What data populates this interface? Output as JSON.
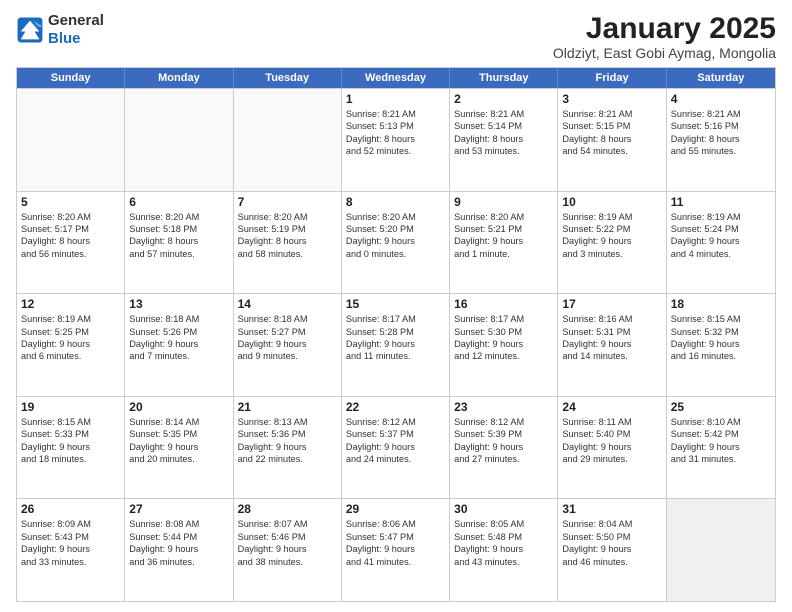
{
  "header": {
    "logo_general": "General",
    "logo_blue": "Blue",
    "month_title": "January 2025",
    "location": "Oldziyt, East Gobi Aymag, Mongolia"
  },
  "days_of_week": [
    "Sunday",
    "Monday",
    "Tuesday",
    "Wednesday",
    "Thursday",
    "Friday",
    "Saturday"
  ],
  "rows": [
    [
      {
        "num": "",
        "lines": [],
        "empty": true
      },
      {
        "num": "",
        "lines": [],
        "empty": true
      },
      {
        "num": "",
        "lines": [],
        "empty": true
      },
      {
        "num": "1",
        "lines": [
          "Sunrise: 8:21 AM",
          "Sunset: 5:13 PM",
          "Daylight: 8 hours",
          "and 52 minutes."
        ],
        "empty": false
      },
      {
        "num": "2",
        "lines": [
          "Sunrise: 8:21 AM",
          "Sunset: 5:14 PM",
          "Daylight: 8 hours",
          "and 53 minutes."
        ],
        "empty": false
      },
      {
        "num": "3",
        "lines": [
          "Sunrise: 8:21 AM",
          "Sunset: 5:15 PM",
          "Daylight: 8 hours",
          "and 54 minutes."
        ],
        "empty": false
      },
      {
        "num": "4",
        "lines": [
          "Sunrise: 8:21 AM",
          "Sunset: 5:16 PM",
          "Daylight: 8 hours",
          "and 55 minutes."
        ],
        "empty": false
      }
    ],
    [
      {
        "num": "5",
        "lines": [
          "Sunrise: 8:20 AM",
          "Sunset: 5:17 PM",
          "Daylight: 8 hours",
          "and 56 minutes."
        ],
        "empty": false
      },
      {
        "num": "6",
        "lines": [
          "Sunrise: 8:20 AM",
          "Sunset: 5:18 PM",
          "Daylight: 8 hours",
          "and 57 minutes."
        ],
        "empty": false
      },
      {
        "num": "7",
        "lines": [
          "Sunrise: 8:20 AM",
          "Sunset: 5:19 PM",
          "Daylight: 8 hours",
          "and 58 minutes."
        ],
        "empty": false
      },
      {
        "num": "8",
        "lines": [
          "Sunrise: 8:20 AM",
          "Sunset: 5:20 PM",
          "Daylight: 9 hours",
          "and 0 minutes."
        ],
        "empty": false
      },
      {
        "num": "9",
        "lines": [
          "Sunrise: 8:20 AM",
          "Sunset: 5:21 PM",
          "Daylight: 9 hours",
          "and 1 minute."
        ],
        "empty": false
      },
      {
        "num": "10",
        "lines": [
          "Sunrise: 8:19 AM",
          "Sunset: 5:22 PM",
          "Daylight: 9 hours",
          "and 3 minutes."
        ],
        "empty": false
      },
      {
        "num": "11",
        "lines": [
          "Sunrise: 8:19 AM",
          "Sunset: 5:24 PM",
          "Daylight: 9 hours",
          "and 4 minutes."
        ],
        "empty": false
      }
    ],
    [
      {
        "num": "12",
        "lines": [
          "Sunrise: 8:19 AM",
          "Sunset: 5:25 PM",
          "Daylight: 9 hours",
          "and 6 minutes."
        ],
        "empty": false
      },
      {
        "num": "13",
        "lines": [
          "Sunrise: 8:18 AM",
          "Sunset: 5:26 PM",
          "Daylight: 9 hours",
          "and 7 minutes."
        ],
        "empty": false
      },
      {
        "num": "14",
        "lines": [
          "Sunrise: 8:18 AM",
          "Sunset: 5:27 PM",
          "Daylight: 9 hours",
          "and 9 minutes."
        ],
        "empty": false
      },
      {
        "num": "15",
        "lines": [
          "Sunrise: 8:17 AM",
          "Sunset: 5:28 PM",
          "Daylight: 9 hours",
          "and 11 minutes."
        ],
        "empty": false
      },
      {
        "num": "16",
        "lines": [
          "Sunrise: 8:17 AM",
          "Sunset: 5:30 PM",
          "Daylight: 9 hours",
          "and 12 minutes."
        ],
        "empty": false
      },
      {
        "num": "17",
        "lines": [
          "Sunrise: 8:16 AM",
          "Sunset: 5:31 PM",
          "Daylight: 9 hours",
          "and 14 minutes."
        ],
        "empty": false
      },
      {
        "num": "18",
        "lines": [
          "Sunrise: 8:15 AM",
          "Sunset: 5:32 PM",
          "Daylight: 9 hours",
          "and 16 minutes."
        ],
        "empty": false
      }
    ],
    [
      {
        "num": "19",
        "lines": [
          "Sunrise: 8:15 AM",
          "Sunset: 5:33 PM",
          "Daylight: 9 hours",
          "and 18 minutes."
        ],
        "empty": false
      },
      {
        "num": "20",
        "lines": [
          "Sunrise: 8:14 AM",
          "Sunset: 5:35 PM",
          "Daylight: 9 hours",
          "and 20 minutes."
        ],
        "empty": false
      },
      {
        "num": "21",
        "lines": [
          "Sunrise: 8:13 AM",
          "Sunset: 5:36 PM",
          "Daylight: 9 hours",
          "and 22 minutes."
        ],
        "empty": false
      },
      {
        "num": "22",
        "lines": [
          "Sunrise: 8:12 AM",
          "Sunset: 5:37 PM",
          "Daylight: 9 hours",
          "and 24 minutes."
        ],
        "empty": false
      },
      {
        "num": "23",
        "lines": [
          "Sunrise: 8:12 AM",
          "Sunset: 5:39 PM",
          "Daylight: 9 hours",
          "and 27 minutes."
        ],
        "empty": false
      },
      {
        "num": "24",
        "lines": [
          "Sunrise: 8:11 AM",
          "Sunset: 5:40 PM",
          "Daylight: 9 hours",
          "and 29 minutes."
        ],
        "empty": false
      },
      {
        "num": "25",
        "lines": [
          "Sunrise: 8:10 AM",
          "Sunset: 5:42 PM",
          "Daylight: 9 hours",
          "and 31 minutes."
        ],
        "empty": false
      }
    ],
    [
      {
        "num": "26",
        "lines": [
          "Sunrise: 8:09 AM",
          "Sunset: 5:43 PM",
          "Daylight: 9 hours",
          "and 33 minutes."
        ],
        "empty": false
      },
      {
        "num": "27",
        "lines": [
          "Sunrise: 8:08 AM",
          "Sunset: 5:44 PM",
          "Daylight: 9 hours",
          "and 36 minutes."
        ],
        "empty": false
      },
      {
        "num": "28",
        "lines": [
          "Sunrise: 8:07 AM",
          "Sunset: 5:46 PM",
          "Daylight: 9 hours",
          "and 38 minutes."
        ],
        "empty": false
      },
      {
        "num": "29",
        "lines": [
          "Sunrise: 8:06 AM",
          "Sunset: 5:47 PM",
          "Daylight: 9 hours",
          "and 41 minutes."
        ],
        "empty": false
      },
      {
        "num": "30",
        "lines": [
          "Sunrise: 8:05 AM",
          "Sunset: 5:48 PM",
          "Daylight: 9 hours",
          "and 43 minutes."
        ],
        "empty": false
      },
      {
        "num": "31",
        "lines": [
          "Sunrise: 8:04 AM",
          "Sunset: 5:50 PM",
          "Daylight: 9 hours",
          "and 46 minutes."
        ],
        "empty": false
      },
      {
        "num": "",
        "lines": [],
        "empty": true
      }
    ]
  ]
}
